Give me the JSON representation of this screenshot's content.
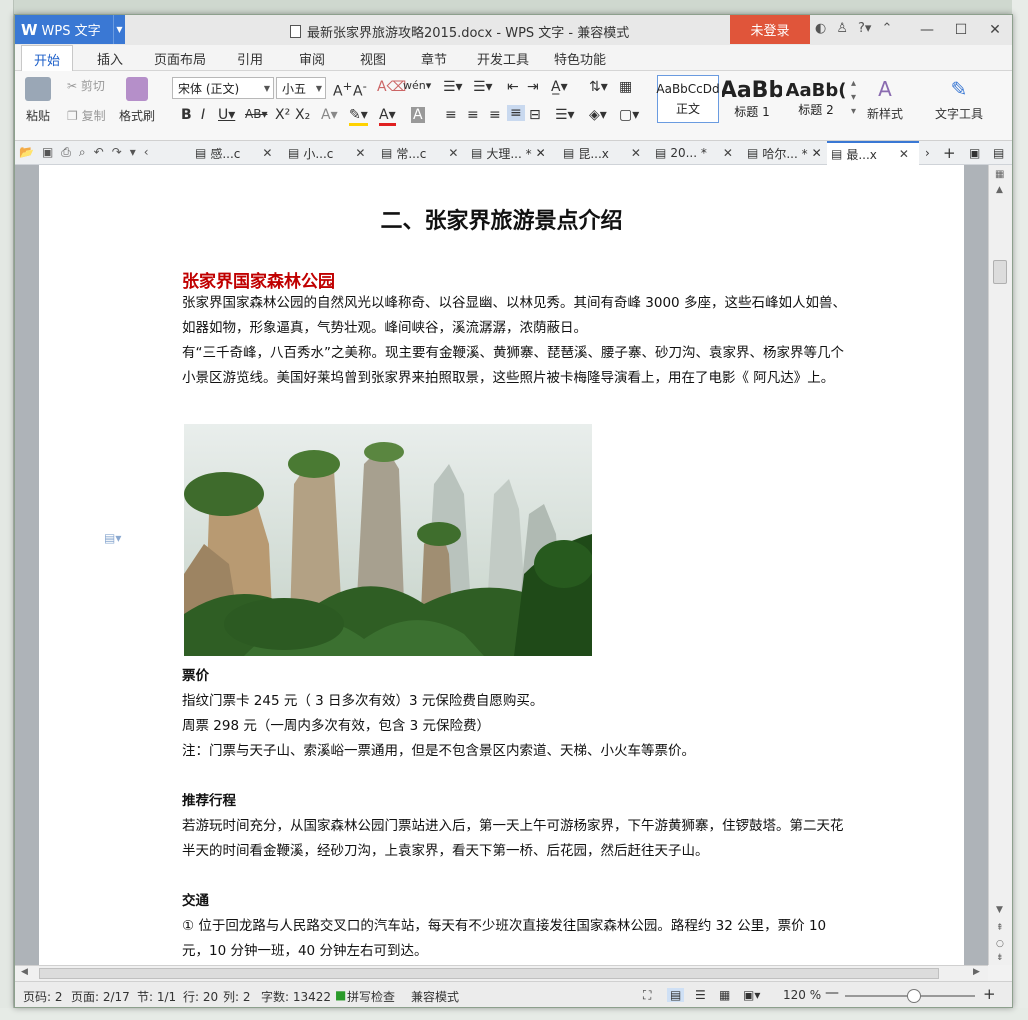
{
  "window": {
    "app_name": "WPS 文字",
    "title": "最新张家界旅游攻略2015.docx - WPS 文字 - 兼容模式",
    "login_label": "未登录"
  },
  "menu": {
    "tabs": [
      "开始",
      "插入",
      "页面布局",
      "引用",
      "审阅",
      "视图",
      "章节",
      "开发工具",
      "特色功能"
    ]
  },
  "ribbon": {
    "paste": "粘贴",
    "cut": "剪切",
    "copy": "复制",
    "format_painter": "格式刷",
    "font_name": "宋体 (正文)",
    "font_size": "小五",
    "styles": [
      {
        "preview": "AaBbCcDd",
        "name": "正文"
      },
      {
        "preview": "AaBb",
        "name": "标题 1"
      },
      {
        "preview": "AaBb(",
        "name": "标题 2"
      }
    ],
    "new_style": "新样式",
    "text_tools": "文字工具"
  },
  "doc_tabs": [
    "感...c",
    "小...c",
    "常...c",
    "大理... *",
    "昆...x",
    "20... *",
    "哈尔... *",
    "最...x"
  ],
  "document": {
    "heading": "二、张家界旅游景点介绍",
    "section_title": "张家界国家森林公园",
    "intro_p1": "张家界国家森林公园的自然风光以峰称奇、以谷显幽、以林见秀。其间有奇峰 3000 多座，这些石峰如人如兽、如器如物，形象逼真，气势壮观。峰间峡谷，溪流潺潺，浓荫蔽日。",
    "intro_p2": "有“三千奇峰，八百秀水”之美称。现主要有金鞭溪、黄狮寨、琵琶溪、腰子寨、砂刀沟、袁家界、杨家界等几个小景区游览线。美国好莱坞曾到张家界来拍照取景，这些照片被卡梅隆导演看上，用在了电影《 阿凡达》上。",
    "ticket_title": "票价",
    "ticket_l1": "指纹门票卡  245 元（  3 日多次有效）3 元保险费自愿购买。",
    "ticket_l2": "周票  298 元（一周内多次有效，包含 3 元保险费）",
    "ticket_note": "注：门票与天子山、索溪峪一票通用，但是不包含景区内索道、天梯、小火车等票价。",
    "route_title": "推荐行程",
    "route_p": "若游玩时间充分，从国家森林公园门票站进入后，第一天上午可游杨家界，下午游黄狮寨，住锣鼓塔。第二天花半天的时间看金鞭溪，经砂刀沟，上袁家界，看天下第一桥、后花园，然后赶往天子山。",
    "traffic_title": "交通",
    "traffic_p": "①  位于回龙路与人民路交叉口的汽车站，每天有不少班次直接发往国家森林公园。路程约 32  公里，票价 10  元，10  分钟一班，40  分钟左右可到达。"
  },
  "status": {
    "page_no": "页码: 2",
    "pages": "页面: 2/17",
    "section": "节: 1/1",
    "row": "行: 20",
    "col": "列: 2",
    "word_count": "字数: 13422",
    "spell": "拼写检查",
    "mode": "兼容模式",
    "zoom": "120 %"
  },
  "colors": {
    "accent": "#3a78d4",
    "login": "#e0553a",
    "section_title": "#c00000"
  }
}
